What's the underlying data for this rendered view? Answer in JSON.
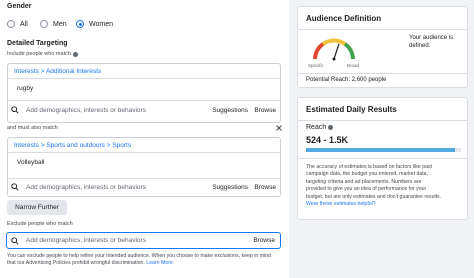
{
  "gender": {
    "label": "Gender",
    "options": [
      {
        "label": "All",
        "selected": false
      },
      {
        "label": "Men",
        "selected": false
      },
      {
        "label": "Women",
        "selected": true
      }
    ]
  },
  "targeting": {
    "title": "Detailed Targeting",
    "include_label": "Include people who match",
    "group1": {
      "breadcrumb": "Interests > Additional Interests",
      "tag": "rugby"
    },
    "search_placeholder": "Add demographics, interests or behaviors",
    "suggestions_label": "Suggestions",
    "browse_label": "Browse",
    "and_also_label": "and must also match",
    "group2": {
      "breadcrumb": "Interests > Sports and outdoors > Sports",
      "tag": "Volleyball"
    },
    "narrow_button": "Narrow Further",
    "exclude_label": "Exclude people who match",
    "disclaimer_line1": "You can exclude people to help refine your intended audience. When you choose to make exclusions, keep in mind",
    "disclaimer_line2": "that our Advertising Policies prohibit wrongful discrimination.",
    "learn_more": "Learn More"
  },
  "audience": {
    "title": "Audience Definition",
    "description": "Your audience is defined.",
    "gauge_specific": "Specific",
    "gauge_broad": "Broad",
    "potential_reach": "Potential Reach: 2,600 people",
    "needle_fraction": 0.6
  },
  "results": {
    "title": "Estimated Daily Results",
    "reach_label": "Reach",
    "reach_value": "524 - 1.5K",
    "bar_fill_fraction": 0.96,
    "note_lines": [
      "The accuracy of estimates is based on factors like past",
      "campaign data, the budget you entered, market data,",
      "targeting criteria and ad placements. Numbers are",
      "provided to give you an idea of performance for your",
      "budget, but are only estimates and don't guarantee results."
    ],
    "helpful_link": "Were these estimates helpful?"
  },
  "colors": {
    "accent": "#1877f2",
    "bar": "#55a7e0",
    "gauge_red": "#e0452e",
    "gauge_yellow": "#f0c23a",
    "gauge_green": "#3fa34d"
  }
}
